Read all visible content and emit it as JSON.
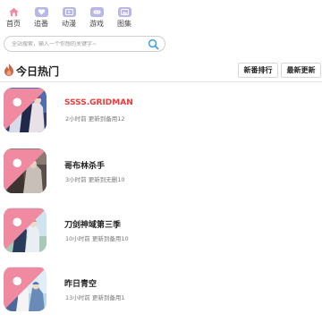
{
  "nav": {
    "items": [
      {
        "label": "首页",
        "icon": "home-icon",
        "active": true
      },
      {
        "label": "追番",
        "icon": "follow-icon",
        "active": false
      },
      {
        "label": "动漫",
        "icon": "anime-icon",
        "active": false
      },
      {
        "label": "游戏",
        "icon": "game-icon",
        "active": false
      },
      {
        "label": "图集",
        "icon": "gallery-icon",
        "active": false
      }
    ]
  },
  "search": {
    "placeholder": "全站搜索，输入一个你想的关键字~",
    "icon": "search-icon"
  },
  "section": {
    "title": "今日热门",
    "icon": "flame-icon",
    "tabs": [
      "新番排行",
      "最新更新"
    ]
  },
  "list": [
    {
      "title": "SSSS.GRIDMAN",
      "meta": "2小时前 更新到备用12",
      "highlight": true
    },
    {
      "title": "哥布林杀手",
      "meta": "3小时前 更新到无删10",
      "highlight": false
    },
    {
      "title": "刀剑神域第三季",
      "meta": "10小时前 更新到备用10",
      "highlight": false
    },
    {
      "title": "昨日青空",
      "meta": "13小时前 更新到备用1",
      "highlight": false
    }
  ],
  "colors": {
    "accent": "#ee3a3a",
    "nav_icon": "#b9b7e6",
    "badge": "#f08aa0",
    "search_icon": "#3aa0e0"
  }
}
